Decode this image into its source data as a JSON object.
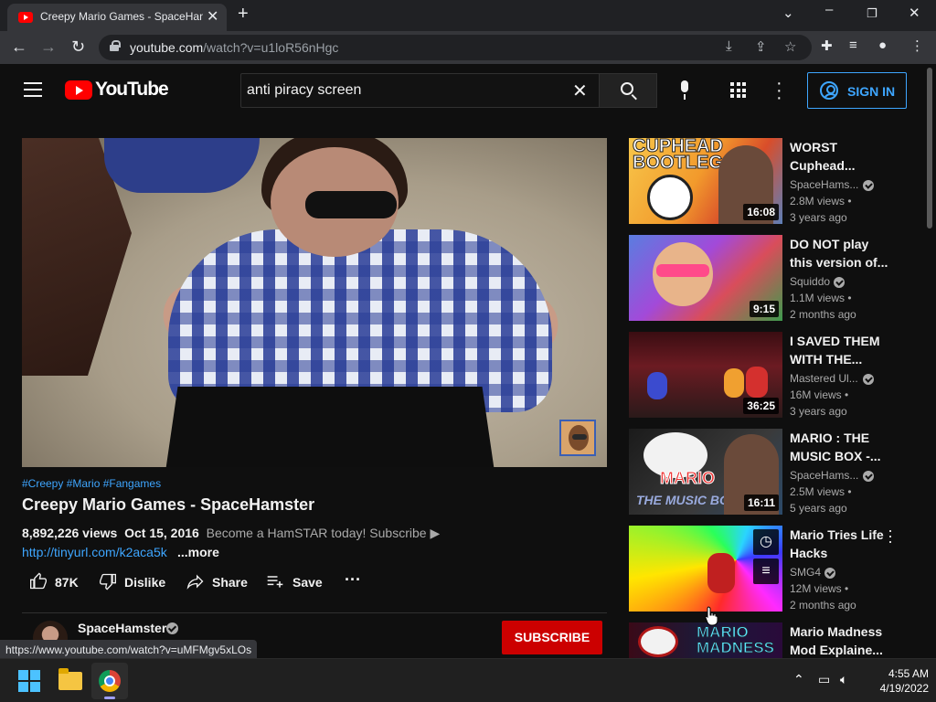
{
  "browser": {
    "tab_title": "Creepy Mario Games - SpaceHamster",
    "url_host": "youtube.com",
    "url_path": "/watch?v=u1loR56nHgc",
    "status_url": "https://www.youtube.com/watch?v=uMFMgv5xLOs"
  },
  "youtube": {
    "logo": "YouTube",
    "search_value": "anti piracy screen",
    "signin_label": "SIGN IN"
  },
  "video": {
    "tags": "#Creepy #Mario #Fangames",
    "title": "Creepy Mario Games - SpaceHamster",
    "views": "8,892,226 views",
    "date": "Oct 15, 2016",
    "description": "Become a HamSTAR today! Subscribe ▶",
    "desc_link": "http://tinyurl.com/k2aca5k",
    "more": "...more",
    "likes": "87K",
    "dislike_label": "Dislike",
    "share_label": "Share",
    "save_label": "Save",
    "more_actions": "···"
  },
  "channel": {
    "name": "SpaceHamster",
    "subscribe_label": "SUBSCRIBE"
  },
  "recommendations": [
    {
      "title": "WORST Cuphead...",
      "channel": "SpaceHams...",
      "views": "2.8M views •",
      "age": "3 years ago",
      "duration": "16:08"
    },
    {
      "title": "DO NOT play this version of...",
      "channel": "Squiddo",
      "views": "1.1M views •",
      "age": "2 months ago",
      "duration": "9:15"
    },
    {
      "title": "I SAVED THEM WITH THE...",
      "channel": "Mastered Ul...",
      "views": "16M views •",
      "age": "3 years ago",
      "duration": "36:25"
    },
    {
      "title": "MARIO : THE MUSIC BOX -...",
      "channel": "SpaceHams...",
      "views": "2.5M views •",
      "age": "5 years ago",
      "duration": "16:11"
    },
    {
      "title": "Mario Tries Life Hacks",
      "channel": "SMG4",
      "views": "12M views •",
      "age": "2 months ago",
      "duration": ""
    },
    {
      "title": "Mario Madness Mod Explaine...",
      "channel": "",
      "views": "",
      "age": "",
      "duration": ""
    }
  ],
  "thumb_text": {
    "cuphead": "CUPHEAD BOOTLEGS!",
    "musicbox_top": "MARIO",
    "musicbox_bottom": "THE MUSIC BOX",
    "madness": "MARIO MADNESS"
  },
  "taskbar": {
    "time": "4:55 AM",
    "date": "4/19/2022"
  }
}
